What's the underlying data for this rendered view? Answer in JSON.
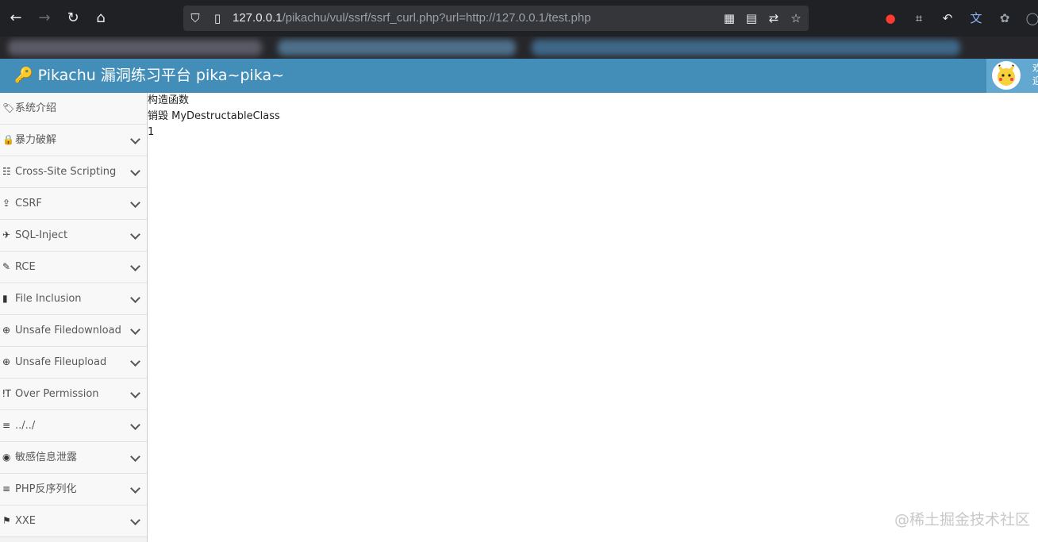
{
  "browser": {
    "url_host": "127.0.0.1",
    "url_rest": "/pikachu/vul/ssrf/ssrf_curl.php?url=http://127.0.0.1/test.php",
    "icons": [
      "back-icon",
      "forward-icon",
      "reload-icon",
      "home-icon",
      "shield-icon",
      "page-info-icon",
      "qr-code-icon",
      "reader-mode-icon",
      "translate-icon",
      "bookmark-star-icon",
      "extension-icon",
      "crop-icon",
      "undo-icon",
      "translate-extension-icon",
      "settings-icon",
      "profile-icon"
    ]
  },
  "header": {
    "title": "Pikachu 漏洞练习平台 pika~pika~",
    "key_icon": "🔍",
    "user_text": "欢迎"
  },
  "sidebar": {
    "items": [
      {
        "label": "系统介绍",
        "icon": "🏷",
        "expandable": false
      },
      {
        "label": "暴力破解",
        "icon": "🔒",
        "expandable": true
      },
      {
        "label": "Cross-Site Scripting",
        "icon": "☷",
        "expandable": true
      },
      {
        "label": "CSRF",
        "icon": "⇪",
        "expandable": true
      },
      {
        "label": "SQL-Inject",
        "icon": "✈",
        "expandable": true
      },
      {
        "label": "RCE",
        "icon": "✎",
        "expandable": true
      },
      {
        "label": "File Inclusion",
        "icon": "▮",
        "expandable": true
      },
      {
        "label": "Unsafe Filedownload",
        "icon": "⊕",
        "expandable": true
      },
      {
        "label": "Unsafe Fileupload",
        "icon": "⊕",
        "expandable": true
      },
      {
        "label": "Over Permission",
        "icon": "ǃT",
        "expandable": true
      },
      {
        "label": "../../",
        "icon": "≡",
        "expandable": true
      },
      {
        "label": "敏感信息泄露",
        "icon": "◉",
        "expandable": true
      },
      {
        "label": "PHP反序列化",
        "icon": "≡",
        "expandable": true
      },
      {
        "label": "XXE",
        "icon": "⚑",
        "expandable": true
      }
    ]
  },
  "content": {
    "lines": [
      "构造函数",
      "销毁 MyDestructableClass",
      "1"
    ]
  },
  "watermark": "@稀土掘金技术社区"
}
